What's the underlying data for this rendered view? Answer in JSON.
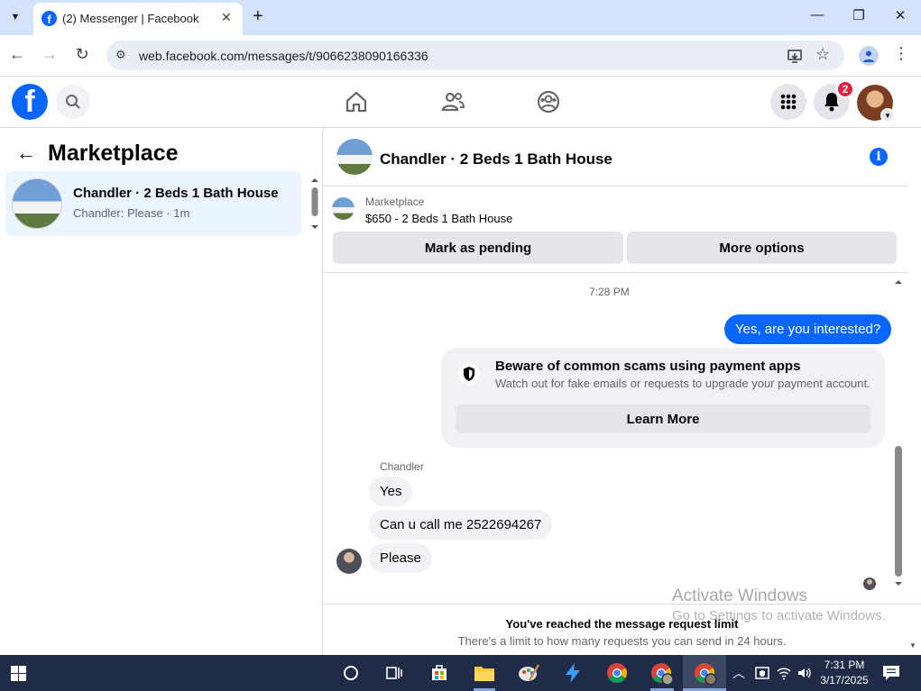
{
  "browser": {
    "tab_title": "(2) Messenger | Facebook",
    "url": "web.facebook.com/messages/t/9066238090166336",
    "favicon_letter": "f",
    "new_tab_symbol": "+",
    "close_symbol": "✕",
    "minimize_symbol": "—",
    "restore_symbol": "❐",
    "window_close_symbol": "✕"
  },
  "header": {
    "logo_letter": "f",
    "notification_count": "2"
  },
  "left_panel": {
    "title": "Marketplace",
    "conversations": [
      {
        "name": "Chandler · 2 Beds 1 Bath House",
        "preview": "Chandler: Please · 1m"
      }
    ]
  },
  "chat": {
    "title": "Chandler · 2 Beds 1 Bath House",
    "listing_category": "Marketplace",
    "listing_price_title": "$650 - 2 Beds 1 Bath House",
    "mark_pending_label": "Mark as pending",
    "more_options_label": "More options",
    "timestamp": "7:28 PM",
    "outgoing_message": "Yes, are you interested?",
    "scam_notice": {
      "title": "Beware of common scams using payment apps",
      "subtitle": "Watch out for fake emails or requests to upgrade your payment account.",
      "button": "Learn More"
    },
    "sender_name": "Chandler",
    "incoming_messages": [
      "Yes",
      "Can u call me 2522694267",
      "Please"
    ],
    "limit_title": "You've reached the message request limit",
    "limit_subtitle": "There's a limit to how many requests you can send in 24 hours."
  },
  "watermark": {
    "line1": "Activate Windows",
    "line2": "Go to Settings to activate Windows."
  },
  "taskbar": {
    "time": "7:31 PM",
    "date": "3/17/2025"
  },
  "colors": {
    "accent": "#0866ff",
    "badge": "#e41e3f",
    "selected_conv": "#ebf5ff",
    "taskbar": "#1f2b47"
  }
}
